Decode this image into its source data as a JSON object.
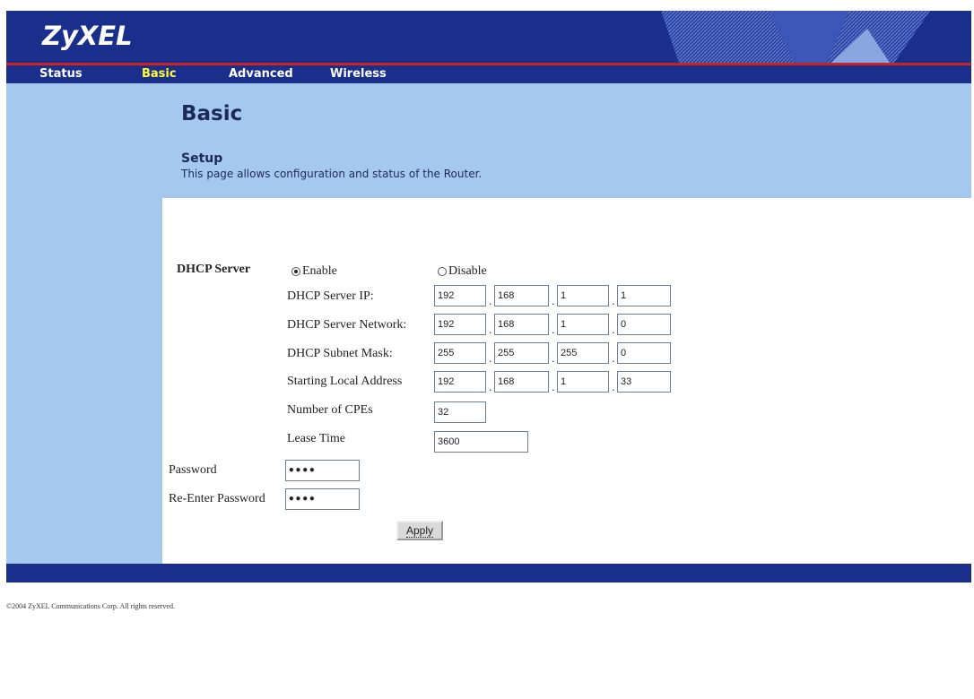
{
  "header": {
    "logo": "ZyXEL"
  },
  "nav": {
    "items": [
      {
        "label": "Status"
      },
      {
        "label": "Basic"
      },
      {
        "label": "Advanced"
      },
      {
        "label": "Wireless"
      }
    ]
  },
  "page": {
    "title": "Basic",
    "section": "Setup",
    "description": "This page allows configuration and status of the Router."
  },
  "dhcp": {
    "label": "DHCP Server",
    "enable_label": "Enable",
    "disable_label": "Disable",
    "selected": "Enable",
    "fields": [
      {
        "label": "DHCP Server IP:",
        "values": [
          "192",
          "168",
          "1",
          "1"
        ]
      },
      {
        "label": "DHCP Server Network:",
        "values": [
          "192",
          "168",
          "1",
          "0"
        ]
      },
      {
        "label": "DHCP Subnet Mask:",
        "values": [
          "255",
          "255",
          "255",
          "0"
        ]
      },
      {
        "label": "Starting Local Address",
        "values": [
          "192",
          "168",
          "1",
          "33"
        ]
      }
    ],
    "cpes": {
      "label": "Number of CPEs",
      "value": "32"
    },
    "lease": {
      "label": "Lease Time",
      "value": "3600"
    }
  },
  "password": {
    "label": "Password",
    "value": "••••"
  },
  "reenter": {
    "label": "Re-Enter Password",
    "value": "••••"
  },
  "apply_label": "Apply",
  "footer": {
    "copyright": "©2004 ZyXEL Communications Corp.   All rights reserved."
  },
  "colors": {
    "header_bg": "#1a2f8c",
    "panel_bg": "#a5c8ee",
    "nav_active": "#ffff33",
    "accent_line": "#cc2222"
  }
}
